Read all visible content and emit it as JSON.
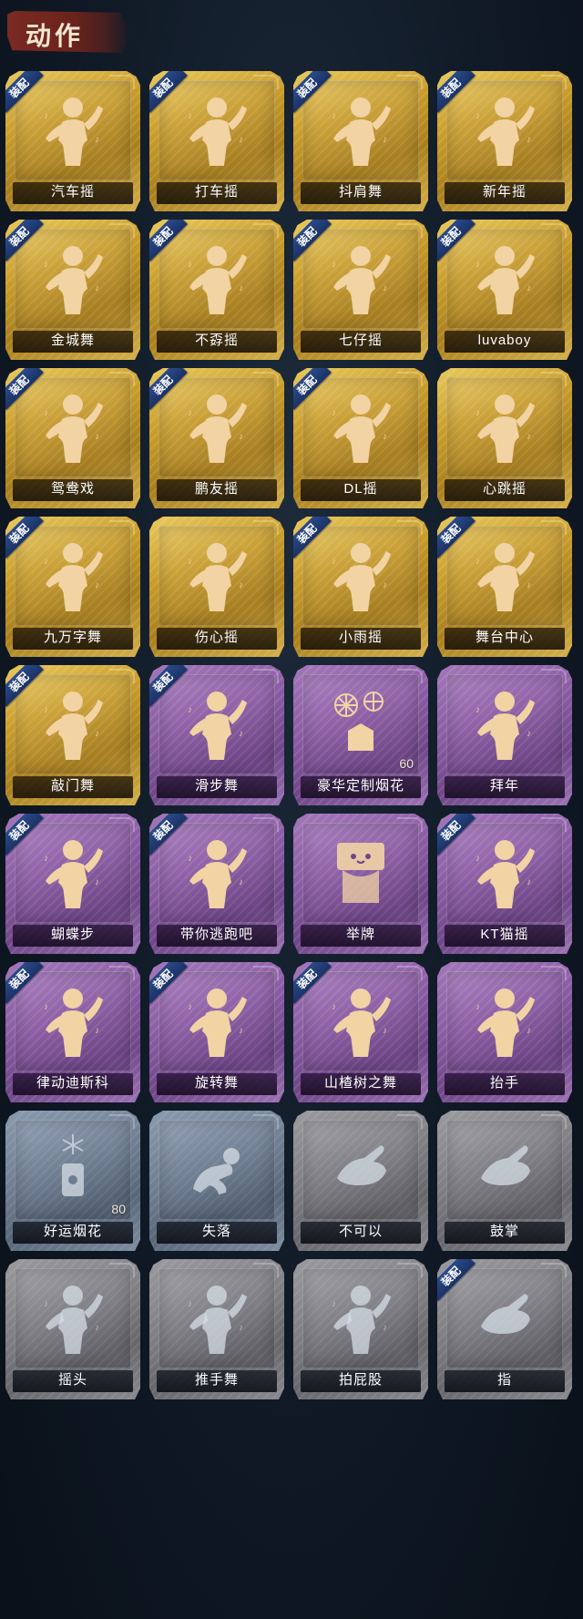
{
  "header": {
    "title": "动作"
  },
  "colors": {
    "gold": "#c99c2a",
    "purple": "#8a5ba3",
    "grayblue": "#6d7c90",
    "gray": "#7c7c82",
    "badge": "#2b4a8a",
    "figure_gold": "#f2d3a4",
    "figure_silver": "#d6dde6"
  },
  "items": [
    {
      "label": "汽车摇",
      "tier": "gold",
      "equipped": true,
      "badge_text": "装配",
      "icon": "dance-figure-icon"
    },
    {
      "label": "打车摇",
      "tier": "gold",
      "equipped": true,
      "badge_text": "装配",
      "icon": "dance-figure-icon"
    },
    {
      "label": "抖肩舞",
      "tier": "gold",
      "equipped": true,
      "badge_text": "装配",
      "icon": "dance-figure-icon"
    },
    {
      "label": "新年摇",
      "tier": "gold",
      "equipped": true,
      "badge_text": "装配",
      "icon": "dance-figure-icon"
    },
    {
      "label": "金城舞",
      "tier": "gold",
      "equipped": true,
      "badge_text": "装配",
      "icon": "dance-figure-icon"
    },
    {
      "label": "不孬摇",
      "tier": "gold",
      "equipped": true,
      "badge_text": "装配",
      "icon": "dance-figure-icon"
    },
    {
      "label": "七仔摇",
      "tier": "gold",
      "equipped": true,
      "badge_text": "装配",
      "icon": "dance-figure-icon"
    },
    {
      "label": "luvaboy",
      "tier": "gold",
      "equipped": true,
      "badge_text": "装配",
      "icon": "dance-figure-icon"
    },
    {
      "label": "鸳鸯戏",
      "tier": "gold",
      "equipped": true,
      "badge_text": "装配",
      "icon": "dance-figure-icon"
    },
    {
      "label": "鹏友摇",
      "tier": "gold",
      "equipped": true,
      "badge_text": "装配",
      "icon": "dance-figure-icon"
    },
    {
      "label": "DL摇",
      "tier": "gold",
      "equipped": true,
      "badge_text": "装配",
      "icon": "dance-figure-icon"
    },
    {
      "label": "心跳摇",
      "tier": "gold",
      "equipped": false,
      "badge_text": "",
      "icon": "dance-figure-icon"
    },
    {
      "label": "九万字舞",
      "tier": "gold",
      "equipped": true,
      "badge_text": "装配",
      "icon": "dance-figure-icon"
    },
    {
      "label": "伤心摇",
      "tier": "gold",
      "equipped": false,
      "badge_text": "",
      "icon": "dance-figure-icon"
    },
    {
      "label": "小雨摇",
      "tier": "gold",
      "equipped": true,
      "badge_text": "装配",
      "icon": "dance-figure-icon"
    },
    {
      "label": "舞台中心",
      "tier": "gold",
      "equipped": true,
      "badge_text": "装配",
      "icon": "dance-figure-icon"
    },
    {
      "label": "敲门舞",
      "tier": "gold",
      "equipped": true,
      "badge_text": "装配",
      "icon": "dance-figure-icon"
    },
    {
      "label": "滑步舞",
      "tier": "purple",
      "equipped": true,
      "badge_text": "装配",
      "icon": "dance-figure-icon"
    },
    {
      "label": "豪华定制烟花",
      "tier": "purple",
      "equipped": false,
      "badge_text": "",
      "icon": "fireworks-box-icon",
      "count": "60"
    },
    {
      "label": "拜年",
      "tier": "purple",
      "equipped": false,
      "badge_text": "",
      "icon": "bow-figure-icon"
    },
    {
      "label": "蝴蝶步",
      "tier": "purple",
      "equipped": true,
      "badge_text": "装配",
      "icon": "dance-figure-icon"
    },
    {
      "label": "带你逃跑吧",
      "tier": "purple",
      "equipped": true,
      "badge_text": "装配",
      "icon": "dance-figure-icon"
    },
    {
      "label": "举牌",
      "tier": "purple",
      "equipped": false,
      "badge_text": "",
      "icon": "hold-sign-icon"
    },
    {
      "label": "KT猫摇",
      "tier": "purple",
      "equipped": true,
      "badge_text": "装配",
      "icon": "dance-figure-icon"
    },
    {
      "label": "律动迪斯科",
      "tier": "purple",
      "equipped": true,
      "badge_text": "装配",
      "icon": "dance-figure-icon"
    },
    {
      "label": "旋转舞",
      "tier": "purple",
      "equipped": true,
      "badge_text": "装配",
      "icon": "dance-figure-icon"
    },
    {
      "label": "山楂树之舞",
      "tier": "purple",
      "equipped": true,
      "badge_text": "装配",
      "icon": "dance-figure-icon"
    },
    {
      "label": "抬手",
      "tier": "purple",
      "equipped": false,
      "badge_text": "",
      "icon": "raise-hand-icon"
    },
    {
      "label": "好运烟花",
      "tier": "grayblue",
      "equipped": false,
      "badge_text": "",
      "icon": "fireworks-can-icon",
      "count": "80"
    },
    {
      "label": "失落",
      "tier": "grayblue",
      "equipped": false,
      "badge_text": "",
      "icon": "kneel-figure-icon"
    },
    {
      "label": "不可以",
      "tier": "gray",
      "equipped": false,
      "badge_text": "",
      "icon": "finger-wag-icon"
    },
    {
      "label": "鼓掌",
      "tier": "gray",
      "equipped": false,
      "badge_text": "",
      "icon": "clap-hands-icon"
    },
    {
      "label": "摇头",
      "tier": "gray",
      "equipped": false,
      "badge_text": "",
      "icon": "shake-head-icon"
    },
    {
      "label": "推手舞",
      "tier": "gray",
      "equipped": false,
      "badge_text": "",
      "icon": "push-hands-icon"
    },
    {
      "label": "拍屁股",
      "tier": "gray",
      "equipped": false,
      "badge_text": "",
      "icon": "pat-figure-icon"
    },
    {
      "label": "指",
      "tier": "gray",
      "equipped": true,
      "badge_text": "装配",
      "icon": "point-hand-icon"
    }
  ]
}
